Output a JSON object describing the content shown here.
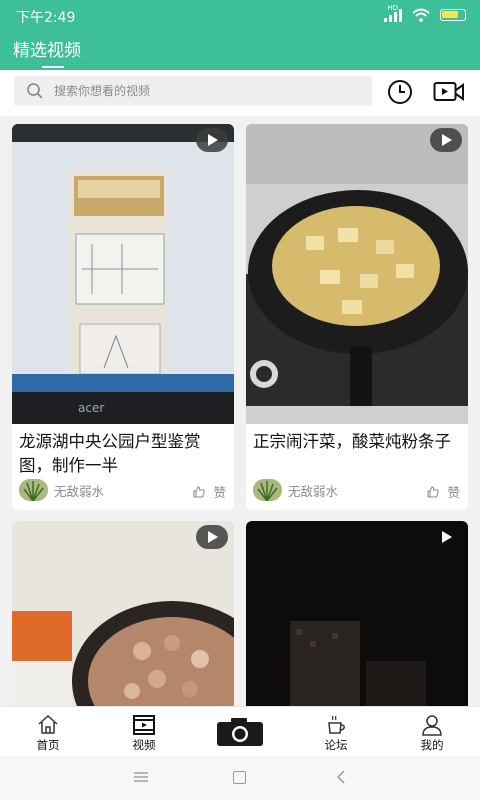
{
  "status_bar": {
    "time": "下午2:49",
    "network_label": "HD"
  },
  "header": {
    "title": "精选视频"
  },
  "search": {
    "placeholder": "搜索你想看的视频"
  },
  "colors": {
    "accent": "#3dbf98",
    "text_secondary": "#8a8a8a"
  },
  "videos": [
    {
      "title": "龙源湖中央公园户型鉴赏图，制作一半",
      "author": "无敌弱水",
      "like_label": "赞"
    },
    {
      "title": "正宗闹汗菜，酸菜炖粉条子",
      "author": "无敌弱水",
      "like_label": "赞"
    },
    {
      "title": "",
      "author": "",
      "like_label": ""
    },
    {
      "title": "",
      "author": "",
      "like_label": ""
    }
  ],
  "bottom_nav": {
    "items": [
      {
        "label": "首页",
        "icon": "home-icon"
      },
      {
        "label": "视频",
        "icon": "video-icon"
      },
      {
        "label": "论坛",
        "icon": "coffee-icon"
      },
      {
        "label": "我的",
        "icon": "user-icon"
      }
    ],
    "camera_icon": "camera-icon"
  },
  "system_nav": {
    "icons": [
      "menu-icon",
      "home-square-icon",
      "back-icon"
    ]
  }
}
